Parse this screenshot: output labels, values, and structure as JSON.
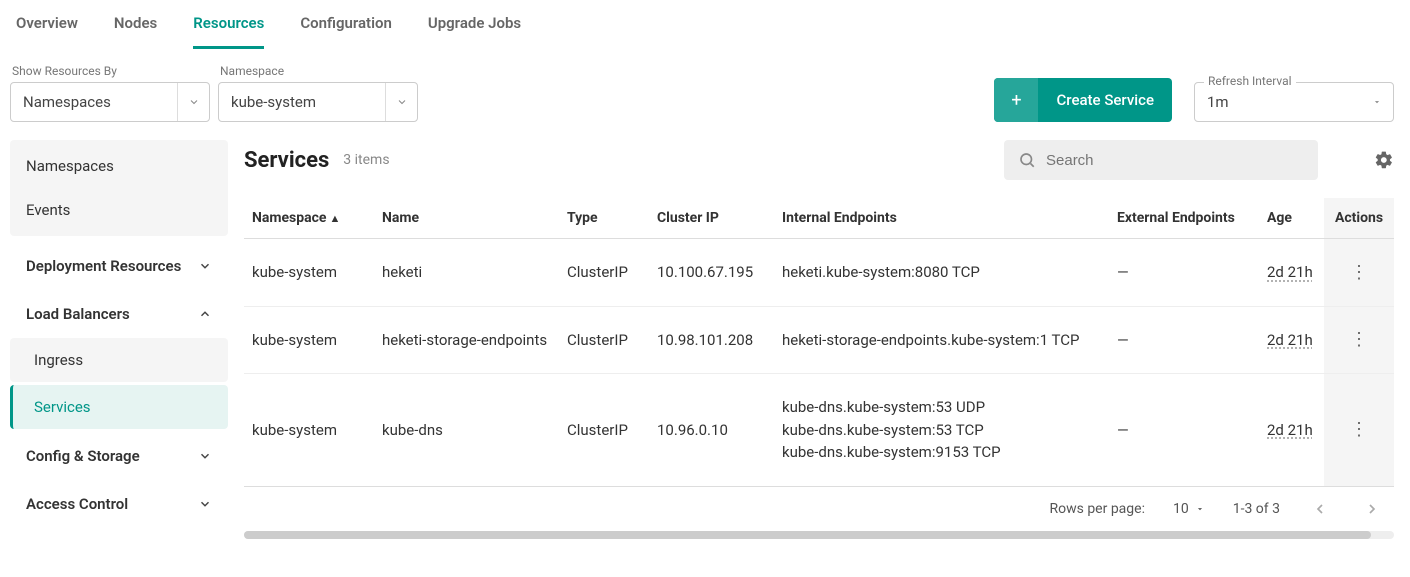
{
  "tabs": [
    {
      "label": "Overview"
    },
    {
      "label": "Nodes"
    },
    {
      "label": "Resources",
      "active": true
    },
    {
      "label": "Configuration"
    },
    {
      "label": "Upgrade Jobs"
    }
  ],
  "filters": {
    "show_by_label": "Show Resources By",
    "show_by_value": "Namespaces",
    "namespace_label": "Namespace",
    "namespace_value": "kube-system"
  },
  "actions": {
    "create_label": "Create Service",
    "plus": "+"
  },
  "refresh": {
    "label": "Refresh Interval",
    "value": "1m"
  },
  "sidebar": {
    "top": [
      {
        "label": "Namespaces"
      },
      {
        "label": "Events"
      }
    ],
    "sections": [
      {
        "label": "Deployment Resources",
        "expanded": false
      },
      {
        "label": "Load Balancers",
        "expanded": true,
        "children": [
          {
            "label": "Ingress"
          },
          {
            "label": "Services",
            "active": true
          }
        ]
      },
      {
        "label": "Config & Storage",
        "expanded": false
      },
      {
        "label": "Access Control",
        "expanded": false
      }
    ]
  },
  "page": {
    "title": "Services",
    "count": "3 items",
    "search_placeholder": "Search"
  },
  "table": {
    "columns": [
      "Namespace",
      "Name",
      "Type",
      "Cluster IP",
      "Internal Endpoints",
      "External Endpoints",
      "Age",
      "Actions"
    ],
    "sort_column": "Namespace",
    "sort_dir": "asc",
    "rows": [
      {
        "namespace": "kube-system",
        "name": "heketi",
        "type": "ClusterIP",
        "cluster_ip": "10.100.67.195",
        "internal_endpoints": [
          "heketi.kube-system:8080 TCP"
        ],
        "external_endpoints": "—",
        "age": "2d 21h"
      },
      {
        "namespace": "kube-system",
        "name": "heketi-storage-endpoints",
        "type": "ClusterIP",
        "cluster_ip": "10.98.101.208",
        "internal_endpoints": [
          "heketi-storage-endpoints.kube-system:1 TCP"
        ],
        "external_endpoints": "—",
        "age": "2d 21h"
      },
      {
        "namespace": "kube-system",
        "name": "kube-dns",
        "type": "ClusterIP",
        "cluster_ip": "10.96.0.10",
        "internal_endpoints": [
          "kube-dns.kube-system:53 UDP",
          "kube-dns.kube-system:53 TCP",
          "kube-dns.kube-system:9153 TCP"
        ],
        "external_endpoints": "—",
        "age": "2d 21h"
      }
    ]
  },
  "pagination": {
    "rows_label": "Rows per page:",
    "rows_value": "10",
    "range": "1-3 of 3"
  }
}
